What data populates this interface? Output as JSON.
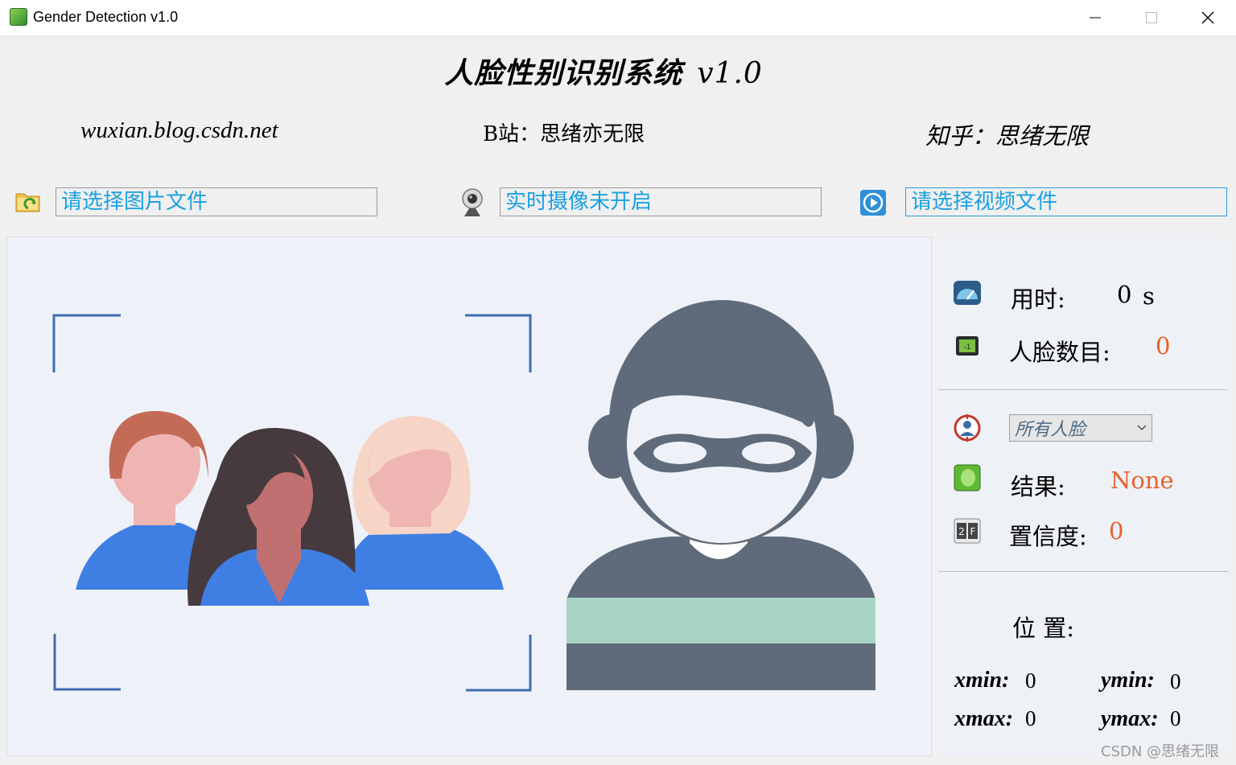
{
  "window": {
    "title": "Gender Detection v1.0",
    "controls": [
      "minimize-icon",
      "maximize-icon",
      "close-icon"
    ]
  },
  "header": {
    "title": "人脸性别识别系统",
    "version": "v1.0",
    "links": {
      "site": "wuxian.blog.csdn.net",
      "bilibili": "B站：思绪亦无限",
      "zhihu": "知乎：思绪无限"
    }
  },
  "sources": {
    "image": {
      "icon": "folder-icon",
      "text": "请选择图片文件"
    },
    "camera": {
      "icon": "webcam-icon",
      "text": "实时摄像未开启"
    },
    "video": {
      "icon": "play-icon",
      "text": "请选择视频文件"
    }
  },
  "stats": {
    "time_label": "用时:",
    "time_value": "0",
    "time_unit": "s",
    "face_count_label": "人脸数目:",
    "face_count_value": "0"
  },
  "selection": {
    "face_select_value": "所有人脸",
    "result_label": "结果:",
    "result_value": "None",
    "confidence_label": "置信度:",
    "confidence_value": "0"
  },
  "position": {
    "label": "位 置:",
    "xmin_label": "xmin:",
    "xmin_value": "0",
    "ymin_label": "ymin:",
    "ymin_value": "0",
    "xmax_label": "xmax:",
    "xmax_value": "0",
    "ymax_label": "ymax:",
    "ymax_value": "0"
  },
  "watermark": "CSDN @思绪无限",
  "colors": {
    "accent_text": "#1aa0e0",
    "value_orange": "#e8602c",
    "figure_gray": "#5f6b7a",
    "stripe_mint": "#a8d4c6",
    "shirt_blue": "#3f7fe4"
  }
}
